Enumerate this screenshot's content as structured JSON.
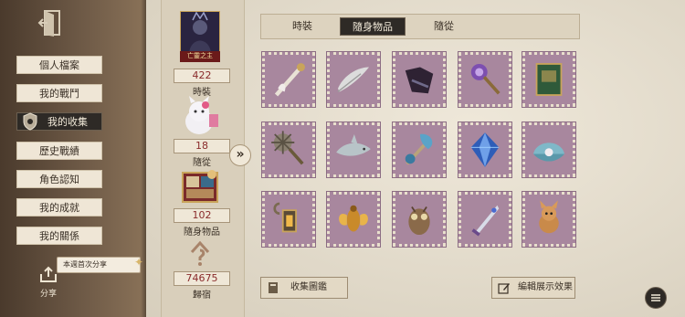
{
  "sidebar": {
    "items": [
      {
        "label": "個人檔案"
      },
      {
        "label": "我的戰鬥"
      },
      {
        "label": "我的收集"
      },
      {
        "label": "歷史戰績"
      },
      {
        "label": "角色認知"
      },
      {
        "label": "我的成就"
      },
      {
        "label": "我的關係"
      }
    ],
    "active_index": 2,
    "share_bubble": "本週首次分享",
    "share_label": "分享"
  },
  "stats": {
    "portrait_caption": "亡靈之主",
    "items": [
      {
        "value": "422",
        "label": "時裝",
        "icon": "costume-portrait-icon"
      },
      {
        "value": "18",
        "label": "隨從",
        "icon": "companion-icon"
      },
      {
        "value": "102",
        "label": "隨身物品",
        "icon": "accessory-box-icon"
      },
      {
        "value": "74675",
        "label": "歸宿",
        "icon": "home-icon"
      }
    ]
  },
  "tabs": [
    {
      "label": "時裝"
    },
    {
      "label": "隨身物品"
    },
    {
      "label": "隨從"
    }
  ],
  "active_tab": 1,
  "grid": {
    "items": [
      {
        "icon": "bone-cane-icon"
      },
      {
        "icon": "feather-quill-icon"
      },
      {
        "icon": "dark-wings-icon"
      },
      {
        "icon": "crystal-mace-icon"
      },
      {
        "icon": "green-book-icon"
      },
      {
        "icon": "spiked-mace-icon"
      },
      {
        "icon": "shark-icon"
      },
      {
        "icon": "seashell-staff-icon"
      },
      {
        "icon": "blue-gem-icon"
      },
      {
        "icon": "oyster-pearl-icon"
      },
      {
        "icon": "lantern-hook-icon"
      },
      {
        "icon": "golden-insect-icon"
      },
      {
        "icon": "clockwork-owl-icon"
      },
      {
        "icon": "ornate-blade-icon"
      },
      {
        "icon": "fox-doll-icon"
      }
    ]
  },
  "buttons": {
    "collection_album": "收集圖鑑",
    "edit_display": "編輯展示效果"
  },
  "colors": {
    "tile_bg": "#a8879e",
    "active_dark": "#2e2a26",
    "stat_value": "#8a2b2b"
  }
}
